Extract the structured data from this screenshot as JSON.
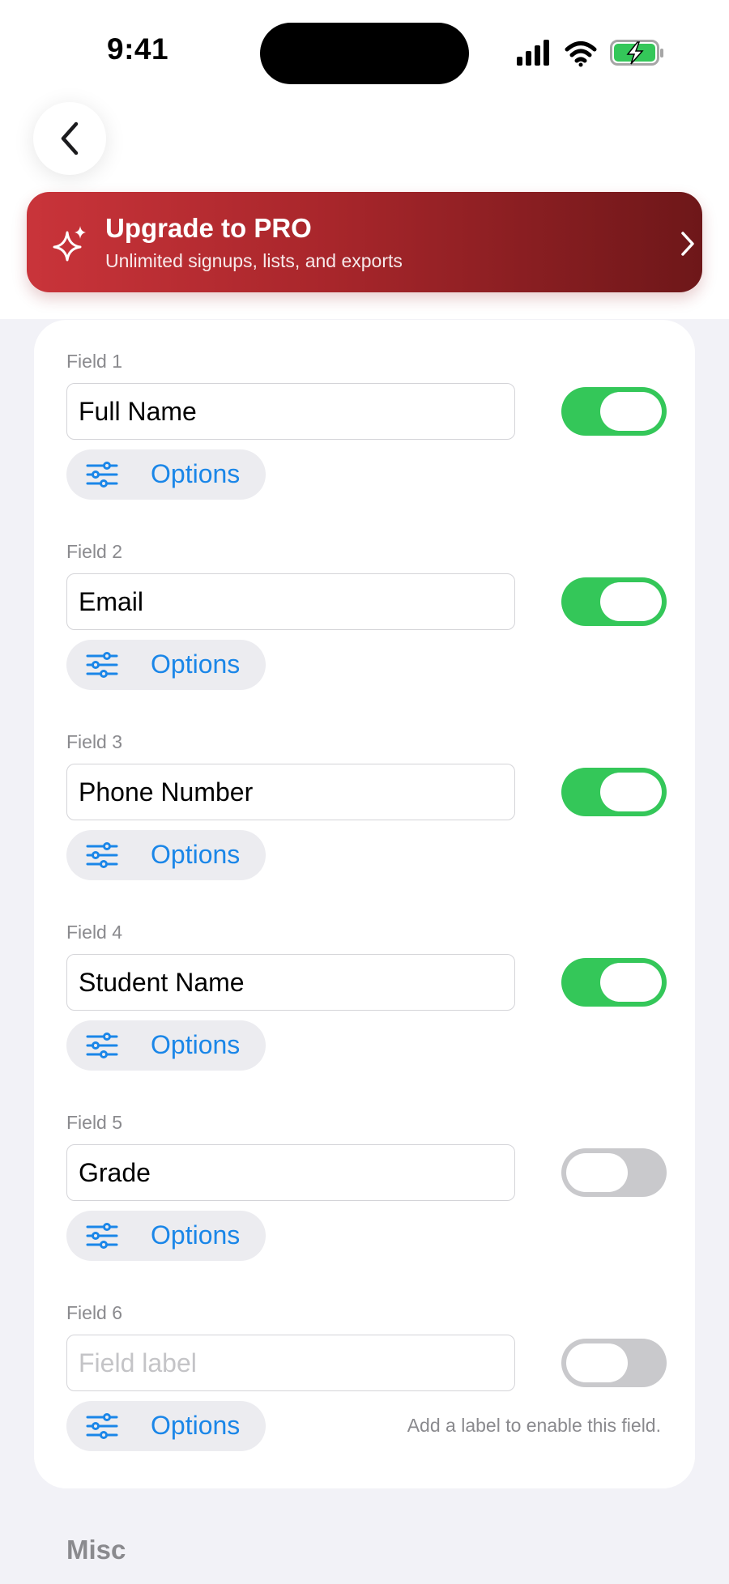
{
  "status_bar": {
    "time": "9:41"
  },
  "upgrade_banner": {
    "title": "Upgrade to PRO",
    "subtitle": "Unlimited signups, lists, and exports"
  },
  "fields": [
    {
      "title": "Field 1",
      "value": "Full Name",
      "placeholder": "",
      "enabled": true,
      "options_label": "Options",
      "hint": ""
    },
    {
      "title": "Field 2",
      "value": "Email",
      "placeholder": "",
      "enabled": true,
      "options_label": "Options",
      "hint": ""
    },
    {
      "title": "Field 3",
      "value": "Phone Number",
      "placeholder": "",
      "enabled": true,
      "options_label": "Options",
      "hint": ""
    },
    {
      "title": "Field 4",
      "value": "Student Name",
      "placeholder": "",
      "enabled": true,
      "options_label": "Options",
      "hint": ""
    },
    {
      "title": "Field 5",
      "value": "Grade",
      "placeholder": "",
      "enabled": false,
      "options_label": "Options",
      "hint": ""
    },
    {
      "title": "Field 6",
      "value": "",
      "placeholder": "Field label",
      "enabled": false,
      "options_label": "Options",
      "hint": "Add a label to enable this field."
    }
  ],
  "misc_section": {
    "title": "Misc"
  },
  "colors": {
    "toggle_on": "#34c759",
    "toggle_off": "#c9c9cc",
    "accent_blue": "#1a86e8",
    "banner_red": "#c9343a",
    "banner_dark": "#6e1719"
  },
  "icons": {
    "back": "chevron-left-icon",
    "banner": "sparkles-icon",
    "banner_arrow": "chevron-right-icon",
    "options": "sliders-icon"
  }
}
